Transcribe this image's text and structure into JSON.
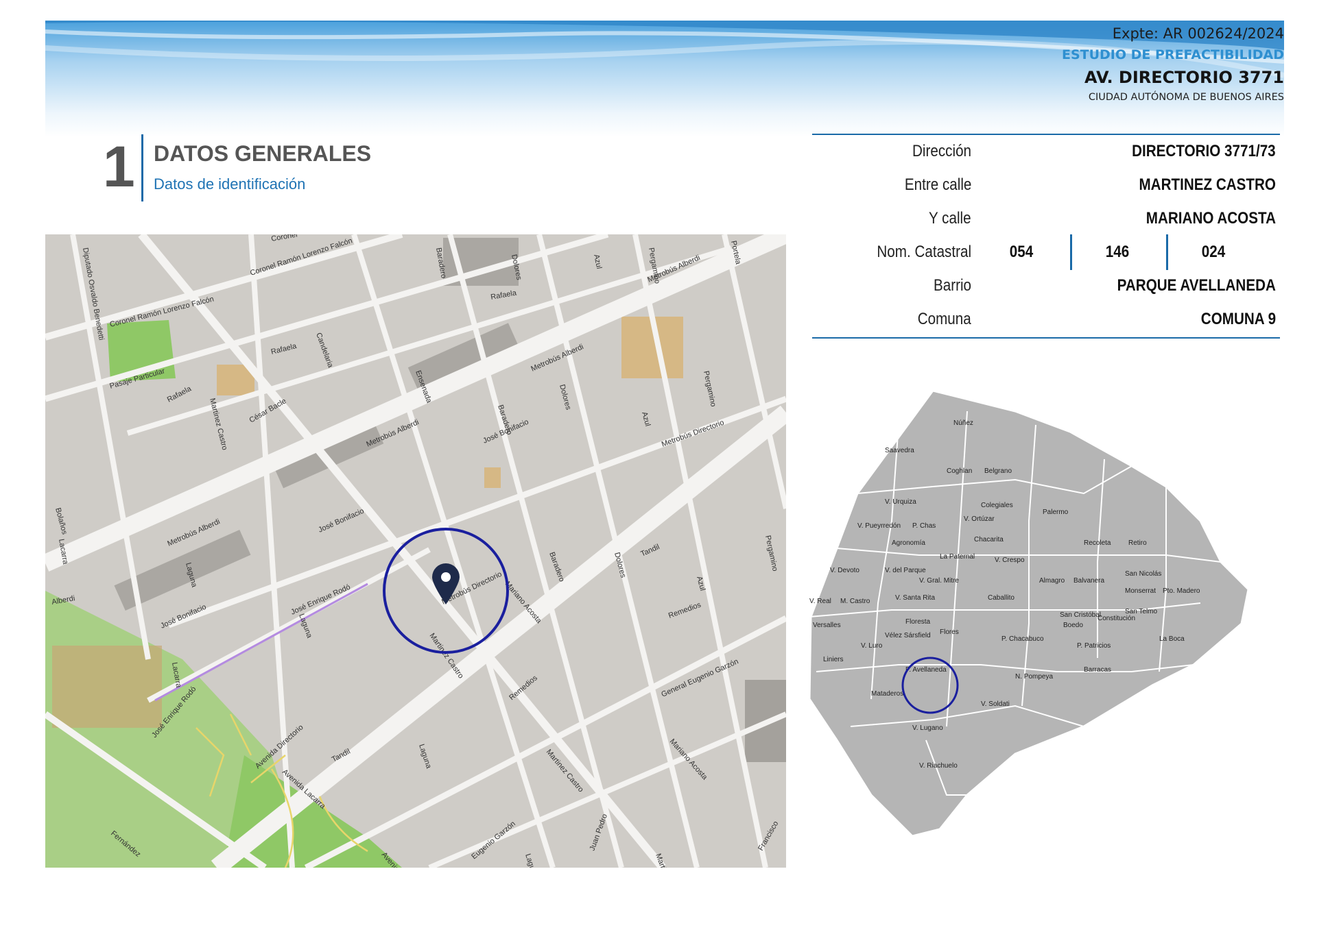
{
  "header": {
    "expte": "Expte: AR 002624/2024",
    "study": "ESTUDIO DE PREFACTIBILIDAD",
    "address": "AV. DIRECTORIO 3771",
    "city": "CIUDAD AUTÓNOMA DE BUENOS AIRES"
  },
  "section": {
    "number": "1",
    "title": "DATOS GENERALES",
    "subtitle": "Datos de identificación"
  },
  "table": {
    "direccion": {
      "label": "Dirección",
      "value": "DIRECTORIO 3771/73"
    },
    "entre_calle": {
      "label": "Entre calle",
      "value": "MARTINEZ CASTRO"
    },
    "y_calle": {
      "label": "Y calle",
      "value": "MARIANO ACOSTA"
    },
    "nom_catastral": {
      "label": "Nom. Catastral",
      "values": [
        "054",
        "146",
        "024"
      ]
    },
    "barrio": {
      "label": "Barrio",
      "value": "PARQUE AVELLANEDA"
    },
    "comuna": {
      "label": "Comuna",
      "value": "COMUNA 9"
    }
  },
  "street_map": {
    "labels": [
      "Coronel Ramón Lorenzo Falcón",
      "Coronel Ramón Lorenzo Falcón",
      "Diputado Osvaldo Benedetti",
      "Pasaje Particular",
      "Rafaela",
      "Rafaela",
      "Rafaela",
      "Candelaria",
      "Martinez Castro",
      "César Bacle",
      "Metrobús Alberdi",
      "Metrobús Alberdi",
      "Metrobús Alberdi",
      "Metrobús Alberdi",
      "Ensenada",
      "Baradero",
      "Baradero",
      "Baradero",
      "Dolores",
      "Dolores",
      "Dolores",
      "Azul",
      "Azul",
      "Azul",
      "Pergamino",
      "Pergamino",
      "Pergamino",
      "Portela",
      "José Bonifacio",
      "José Bonifacio",
      "José Bonifacio",
      "Metrobús Directorio",
      "Metrobús Directorio",
      "Mariano Acosta",
      "Mariano Acosta",
      "Tandil",
      "Tandil",
      "Remedios",
      "Remedios",
      "General Eugenio Garzón",
      "Eugenio Garzón",
      "Laguna",
      "Laguna",
      "Laguna",
      "Laguna",
      "José Enrique Rodó",
      "José Enrique Rodó",
      "Lacarra",
      "Lacarra",
      "Avenida Directorio",
      "Avenida Lacarra",
      "Fernández",
      "Bolaños",
      "Alberdi",
      "Martinez Castro",
      "Martinez Castro",
      "Martinez Castro",
      "Francisco",
      "Juan Pedro",
      "Coronel",
      "Avenida L"
    ]
  },
  "barrios_map": {
    "labels": [
      "Núñez",
      "Saavedra",
      "Coghlan",
      "Belgrano",
      "V. Urquiza",
      "Colegiales",
      "Palermo",
      "V. Pueyrredón",
      "P. Chas",
      "V. Ortúzar",
      "Agronomía",
      "Chacarita",
      "Recoleta",
      "Retiro",
      "La Paternal",
      "V. Crespo",
      "V. Devoto",
      "V. del Parque",
      "Almagro",
      "Balvanera",
      "San Nicolás",
      "V. Gral. Mitre",
      "Monserrat",
      "Pto. Madero",
      "V. Real",
      "M. Castro",
      "V. Santa Rita",
      "Caballito",
      "San Telmo",
      "San Cristóbal",
      "Constitución",
      "Versalles",
      "Floresta",
      "Boedo",
      "Vélez Sársfield",
      "Flores",
      "La Boca",
      "V. Luro",
      "P. Chacabuco",
      "P. Patricios",
      "Liniers",
      "P. Avellaneda",
      "Barracas",
      "N. Pompeya",
      "Mataderos",
      "V. Soldati",
      "V. Lugano",
      "V. Riachuelo"
    ]
  }
}
